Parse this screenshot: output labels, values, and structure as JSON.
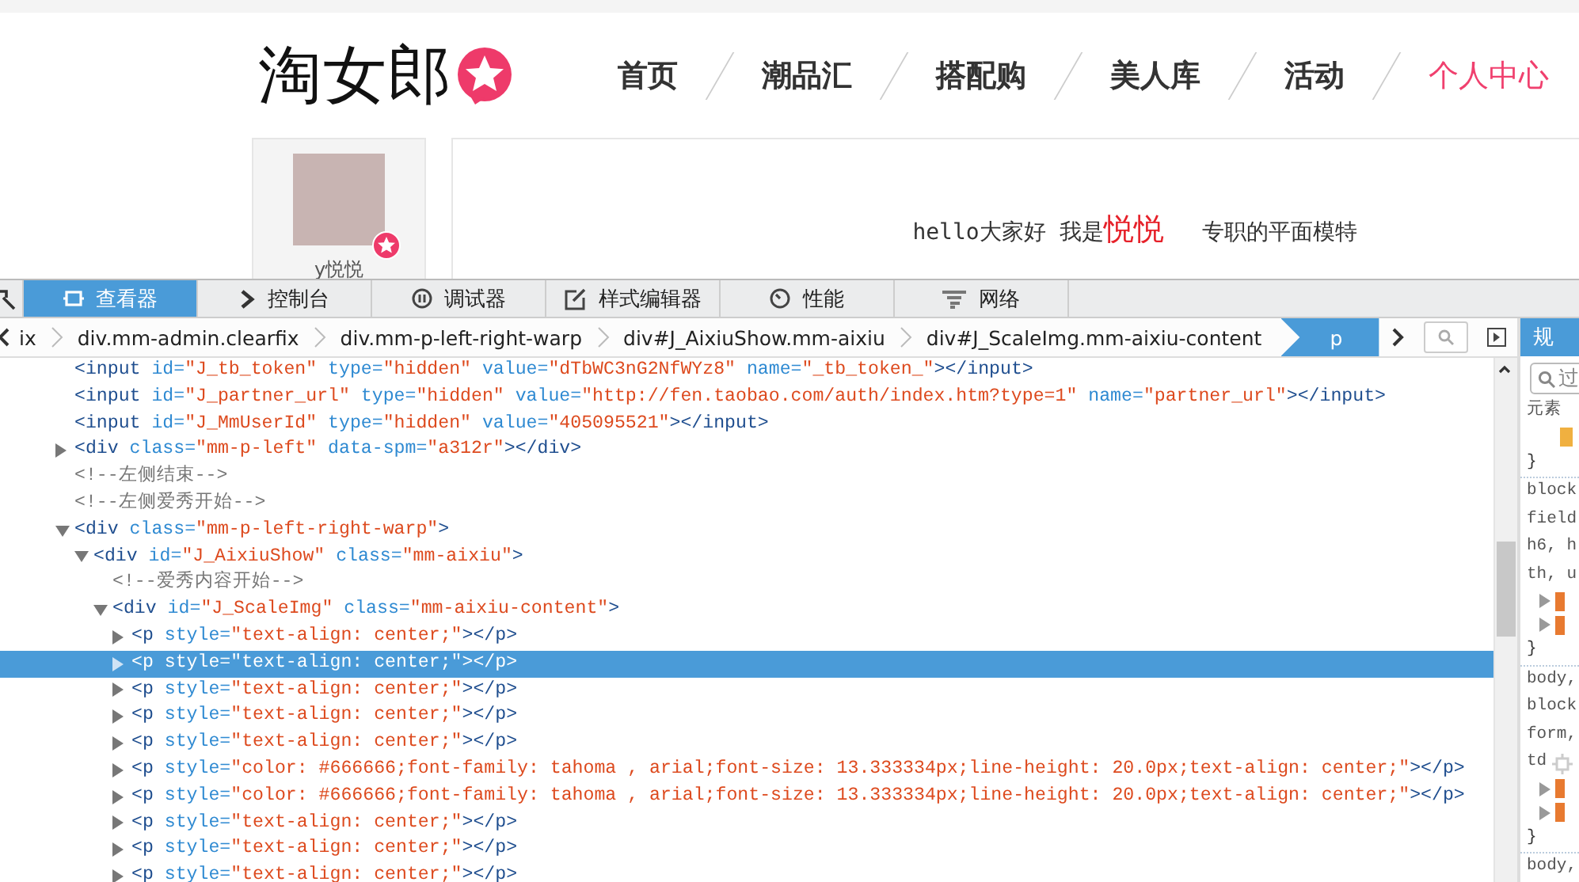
{
  "site": {
    "logo": "淘女郎",
    "nav": [
      {
        "label": "首页",
        "selected": false
      },
      {
        "label": "潮品汇",
        "selected": false
      },
      {
        "label": "搭配购",
        "selected": false
      },
      {
        "label": "美人库",
        "selected": false
      },
      {
        "label": "活动",
        "selected": false
      },
      {
        "label": "个人中心",
        "selected": true
      }
    ],
    "profile": {
      "name": "y悦悦"
    },
    "intro": [
      {
        "text": "hello大家好 我是",
        "emphasis": false
      },
      {
        "text": "悦悦",
        "emphasis": true
      },
      {
        "text": "专职的平面模特",
        "emphasis": false
      }
    ]
  },
  "devtools": {
    "tabs": [
      {
        "label": "查看器",
        "kind": "inspector",
        "selected": true
      },
      {
        "label": "控制台",
        "kind": "console",
        "selected": false
      },
      {
        "label": "调试器",
        "kind": "debugger",
        "selected": false
      },
      {
        "label": "样式编辑器",
        "kind": "style",
        "selected": false
      },
      {
        "label": "性能",
        "kind": "performance",
        "selected": false
      },
      {
        "label": "网络",
        "kind": "network",
        "selected": false
      }
    ],
    "breadcrumbs": [
      {
        "label": "ix",
        "selected": false
      },
      {
        "label": "div.mm-admin.clearfix",
        "selected": false
      },
      {
        "label": "div.mm-p-left-right-warp",
        "selected": false
      },
      {
        "label": "div#J_AixiuShow.mm-aixiu",
        "selected": false
      },
      {
        "label": "div#J_ScaleImg.mm-aixiu-content",
        "selected": false
      },
      {
        "label": "p",
        "selected": true
      }
    ],
    "tree": [
      {
        "kind": "none",
        "selected": false,
        "parts": [
          {
            "kind": "tag",
            "text": "<input"
          },
          {
            "kind": "attr",
            "text": " id="
          },
          {
            "kind": "value",
            "text": "\"J_tb_token\""
          },
          {
            "kind": "attr",
            "text": " type="
          },
          {
            "kind": "value",
            "text": "\"hidden\""
          },
          {
            "kind": "attr",
            "text": " value="
          },
          {
            "kind": "value",
            "text": "\"dTbWC3nG2NfWYz8\""
          },
          {
            "kind": "attr",
            "text": " name="
          },
          {
            "kind": "value",
            "text": "\"_tb_token_\""
          },
          {
            "kind": "tag",
            "text": "></input>"
          }
        ]
      },
      {
        "kind": "none",
        "selected": false,
        "parts": [
          {
            "kind": "tag",
            "text": "<input"
          },
          {
            "kind": "attr",
            "text": " id="
          },
          {
            "kind": "value",
            "text": "\"J_partner_url\""
          },
          {
            "kind": "attr",
            "text": " type="
          },
          {
            "kind": "value",
            "text": "\"hidden\""
          },
          {
            "kind": "attr",
            "text": " value="
          },
          {
            "kind": "value",
            "text": "\"http://fen.taobao.com/auth/index.htm?type=1\""
          },
          {
            "kind": "attr",
            "text": " name="
          },
          {
            "kind": "value",
            "text": "\"partner_url\""
          },
          {
            "kind": "tag",
            "text": "></input>"
          }
        ]
      },
      {
        "kind": "none",
        "selected": false,
        "parts": [
          {
            "kind": "tag",
            "text": "<input"
          },
          {
            "kind": "attr",
            "text": " id="
          },
          {
            "kind": "value",
            "text": "\"J_MmUserId\""
          },
          {
            "kind": "attr",
            "text": " type="
          },
          {
            "kind": "value",
            "text": "\"hidden\""
          },
          {
            "kind": "attr",
            "text": " value="
          },
          {
            "kind": "value",
            "text": "\"405095521\""
          },
          {
            "kind": "tag",
            "text": "></input>"
          }
        ]
      },
      {
        "kind": "collapsed",
        "selected": false,
        "parts": [
          {
            "kind": "tag",
            "text": "<div"
          },
          {
            "kind": "attr",
            "text": " class="
          },
          {
            "kind": "value",
            "text": "\"mm-p-left\""
          },
          {
            "kind": "attr",
            "text": " data-spm="
          },
          {
            "kind": "value",
            "text": "\"a312r\""
          },
          {
            "kind": "tag",
            "text": "></div>"
          }
        ]
      },
      {
        "kind": "none",
        "selected": false,
        "parts": [
          {
            "kind": "comment",
            "text": "<!--左侧结束-->"
          }
        ]
      },
      {
        "kind": "none",
        "selected": false,
        "parts": [
          {
            "kind": "comment",
            "text": "<!--左侧爱秀开始-->"
          }
        ]
      },
      {
        "kind": "expanded",
        "selected": false,
        "parts": [
          {
            "kind": "tag",
            "text": "<div"
          },
          {
            "kind": "attr",
            "text": " class="
          },
          {
            "kind": "value",
            "text": "\"mm-p-left-right-warp\""
          },
          {
            "kind": "tag",
            "text": ">"
          }
        ],
        "children": [
          {
            "kind": "expanded",
            "selected": false,
            "parts": [
              {
                "kind": "tag",
                "text": "<div"
              },
              {
                "kind": "attr",
                "text": " id="
              },
              {
                "kind": "value",
                "text": "\"J_AixiuShow\""
              },
              {
                "kind": "attr",
                "text": " class="
              },
              {
                "kind": "value",
                "text": "\"mm-aixiu\""
              },
              {
                "kind": "tag",
                "text": ">"
              }
            ],
            "children": [
              {
                "kind": "none",
                "selected": false,
                "parts": [
                  {
                    "kind": "comment",
                    "text": "<!--爱秀内容开始-->"
                  }
                ]
              },
              {
                "kind": "expanded",
                "selected": false,
                "parts": [
                  {
                    "kind": "tag",
                    "text": "<div"
                  },
                  {
                    "kind": "attr",
                    "text": " id="
                  },
                  {
                    "kind": "value",
                    "text": "\"J_ScaleImg\""
                  },
                  {
                    "kind": "attr",
                    "text": " class="
                  },
                  {
                    "kind": "value",
                    "text": "\"mm-aixiu-content\""
                  },
                  {
                    "kind": "tag",
                    "text": ">"
                  }
                ],
                "children": [
                  {
                    "kind": "collapsed",
                    "selected": false,
                    "parts": [
                      {
                        "kind": "tag",
                        "text": "<p"
                      },
                      {
                        "kind": "attr",
                        "text": " style="
                      },
                      {
                        "kind": "value",
                        "text": "\"text-align: center;\""
                      },
                      {
                        "kind": "tag",
                        "text": "></p>"
                      }
                    ]
                  },
                  {
                    "kind": "collapsed",
                    "selected": true,
                    "parts": [
                      {
                        "kind": "tag",
                        "text": "<p"
                      },
                      {
                        "kind": "attr",
                        "text": " style="
                      },
                      {
                        "kind": "value",
                        "text": "\"text-align: center;\""
                      },
                      {
                        "kind": "tag",
                        "text": "></p>"
                      }
                    ]
                  },
                  {
                    "kind": "collapsed",
                    "selected": false,
                    "parts": [
                      {
                        "kind": "tag",
                        "text": "<p"
                      },
                      {
                        "kind": "attr",
                        "text": " style="
                      },
                      {
                        "kind": "value",
                        "text": "\"text-align: center;\""
                      },
                      {
                        "kind": "tag",
                        "text": "></p>"
                      }
                    ]
                  },
                  {
                    "kind": "collapsed",
                    "selected": false,
                    "parts": [
                      {
                        "kind": "tag",
                        "text": "<p"
                      },
                      {
                        "kind": "attr",
                        "text": " style="
                      },
                      {
                        "kind": "value",
                        "text": "\"text-align: center;\""
                      },
                      {
                        "kind": "tag",
                        "text": "></p>"
                      }
                    ]
                  },
                  {
                    "kind": "collapsed",
                    "selected": false,
                    "parts": [
                      {
                        "kind": "tag",
                        "text": "<p"
                      },
                      {
                        "kind": "attr",
                        "text": " style="
                      },
                      {
                        "kind": "value",
                        "text": "\"text-align: center;\""
                      },
                      {
                        "kind": "tag",
                        "text": "></p>"
                      }
                    ]
                  },
                  {
                    "kind": "collapsed",
                    "selected": false,
                    "parts": [
                      {
                        "kind": "tag",
                        "text": "<p"
                      },
                      {
                        "kind": "attr",
                        "text": " style="
                      },
                      {
                        "kind": "value",
                        "text": "\"color: #666666;font-family: tahoma , arial;font-size: 13.333334px;line-height: 20.0px;text-align: center;\""
                      },
                      {
                        "kind": "tag",
                        "text": "></p>"
                      }
                    ]
                  },
                  {
                    "kind": "collapsed",
                    "selected": false,
                    "parts": [
                      {
                        "kind": "tag",
                        "text": "<p"
                      },
                      {
                        "kind": "attr",
                        "text": " style="
                      },
                      {
                        "kind": "value",
                        "text": "\"color: #666666;font-family: tahoma , arial;font-size: 13.333334px;line-height: 20.0px;text-align: center;\""
                      },
                      {
                        "kind": "tag",
                        "text": "></p>"
                      }
                    ]
                  },
                  {
                    "kind": "collapsed",
                    "selected": false,
                    "parts": [
                      {
                        "kind": "tag",
                        "text": "<p"
                      },
                      {
                        "kind": "attr",
                        "text": " style="
                      },
                      {
                        "kind": "value",
                        "text": "\"text-align: center;\""
                      },
                      {
                        "kind": "tag",
                        "text": "></p>"
                      }
                    ]
                  },
                  {
                    "kind": "collapsed",
                    "selected": false,
                    "parts": [
                      {
                        "kind": "tag",
                        "text": "<p"
                      },
                      {
                        "kind": "attr",
                        "text": " style="
                      },
                      {
                        "kind": "value",
                        "text": "\"text-align: center;\""
                      },
                      {
                        "kind": "tag",
                        "text": "></p>"
                      }
                    ]
                  },
                  {
                    "kind": "collapsed",
                    "selected": false,
                    "parts": [
                      {
                        "kind": "tag",
                        "text": "<p"
                      },
                      {
                        "kind": "attr",
                        "text": " style="
                      },
                      {
                        "kind": "value",
                        "text": "\"text-align: center;\""
                      },
                      {
                        "kind": "tag",
                        "text": "></p>"
                      }
                    ]
                  }
                ]
              }
            ]
          }
        ]
      }
    ],
    "side_panel": {
      "tab": "规",
      "search_placeholder": "过",
      "lines": [
        {
          "kind": "selector",
          "text": "元素"
        },
        {
          "kind": "prop"
        },
        {
          "kind": "close",
          "text": "}"
        },
        {
          "kind": "selector",
          "text": "block"
        },
        {
          "kind": "selector",
          "text": "field"
        },
        {
          "kind": "selector",
          "text": "h6, h"
        },
        {
          "kind": "selector",
          "text": "th, u"
        },
        {
          "kind": "inherited"
        },
        {
          "kind": "inherited"
        },
        {
          "kind": "close",
          "text": "}"
        },
        {
          "kind": "selector",
          "text": "body,"
        },
        {
          "kind": "selector",
          "text": "block"
        },
        {
          "kind": "selector",
          "text": "form,"
        },
        {
          "kind": "highlight",
          "text": "td"
        },
        {
          "kind": "inherited"
        },
        {
          "kind": "inherited"
        },
        {
          "kind": "close",
          "text": "}"
        },
        {
          "kind": "selector",
          "text": "body,"
        }
      ]
    }
  }
}
